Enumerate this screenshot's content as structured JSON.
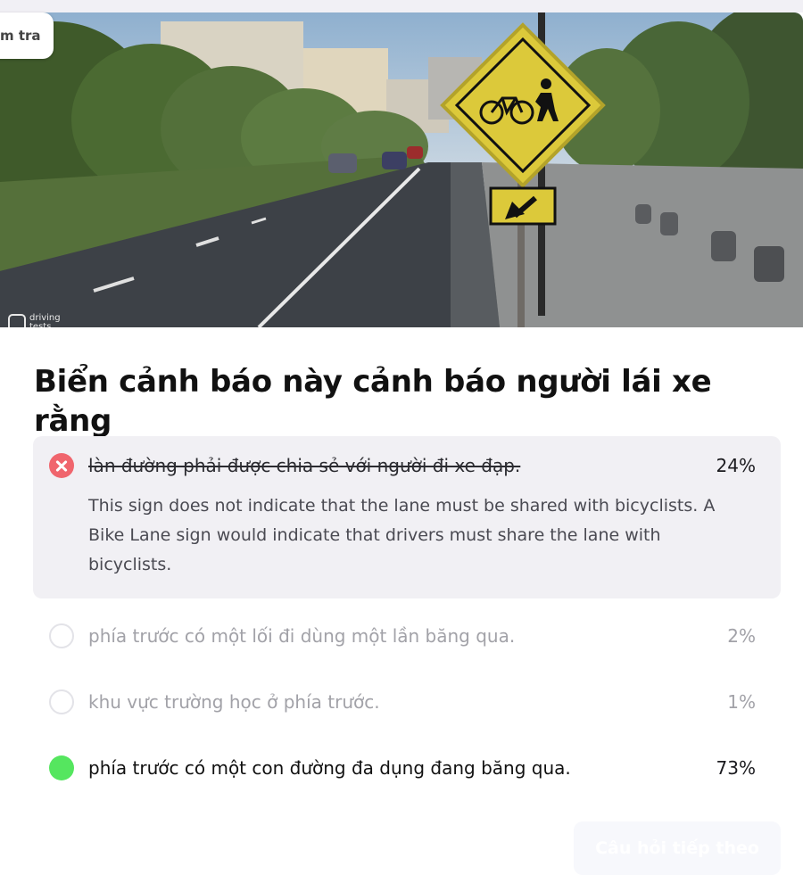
{
  "header": {
    "check_label": "m tra"
  },
  "image": {
    "brand_top": "driving",
    "brand_bottom": "tests"
  },
  "question": {
    "text": "Biển cảnh báo này cảnh báo người lái xe rằng"
  },
  "answers": [
    {
      "text": "làn đường phải được chia sẻ với người đi xe đạp.",
      "percent": "24%",
      "state": "wrong",
      "explanation": "This sign does not indicate that the lane must be shared with bicyclists. A Bike Lane sign would indicate that drivers must share the lane with bicyclists."
    },
    {
      "text": "phía trước có một lối đi dùng một lần băng qua.",
      "percent": "2%",
      "state": "unselected"
    },
    {
      "text": "khu vực trường học ở phía trước.",
      "percent": "1%",
      "state": "unselected"
    },
    {
      "text": "phía trước có một con đường đa dụng đang băng qua.",
      "percent": "73%",
      "state": "correct"
    }
  ],
  "footer": {
    "next_label": "Câu hỏi tiếp theo"
  },
  "colors": {
    "wrong": "#f0656d",
    "correct": "#55e65f",
    "selected_bg": "#f1f0f4",
    "sign_yellow": "#d8c536"
  },
  "icons": {
    "wrong_marker": "x-circle-icon",
    "correct_marker": "filled-circle-icon",
    "empty_marker": "empty-circle-icon",
    "sign_symbols": [
      "bicycle-icon",
      "pedestrian-icon",
      "diagonal-arrow-icon"
    ]
  }
}
